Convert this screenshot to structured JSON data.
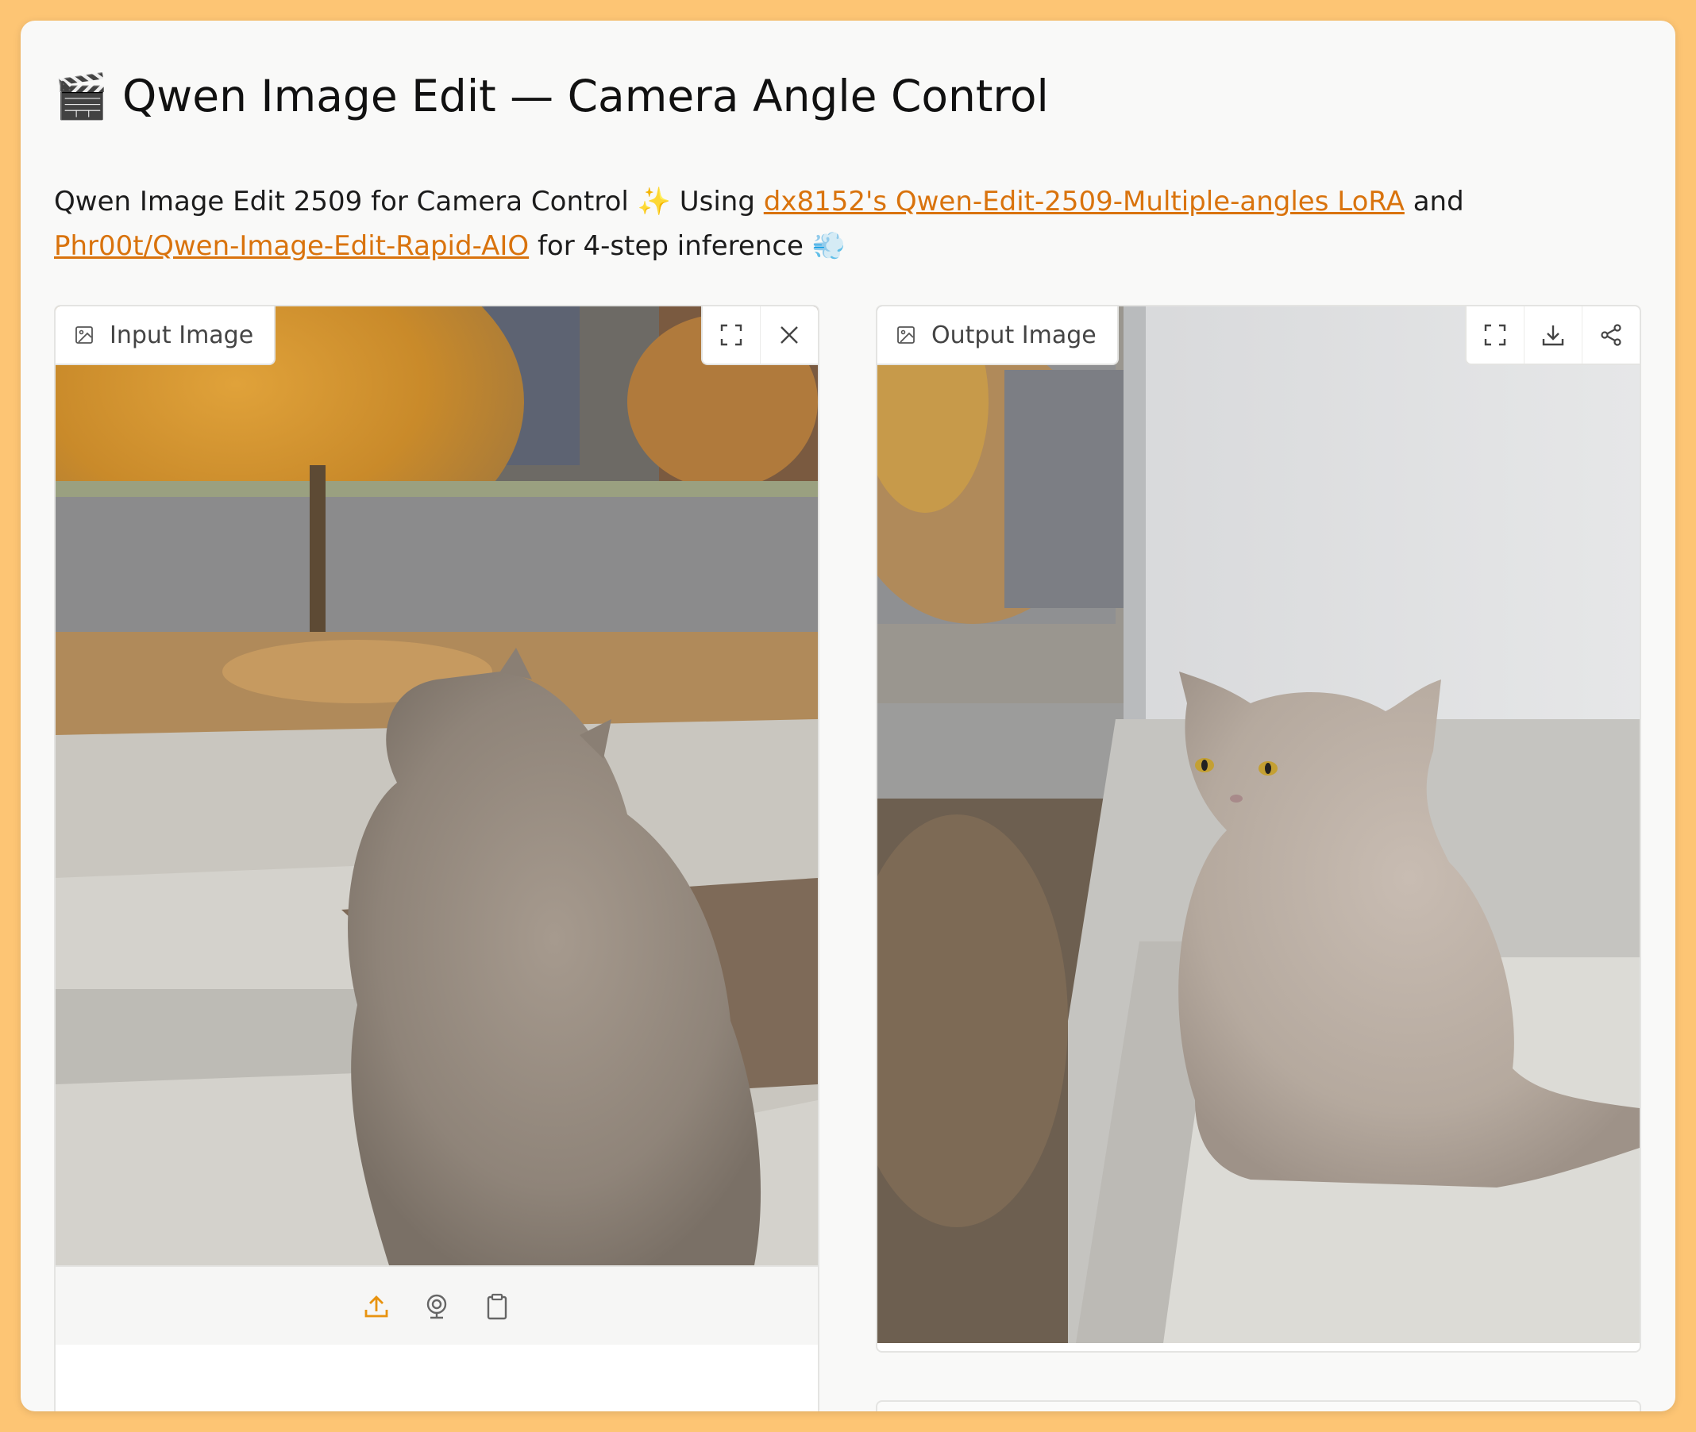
{
  "app": {
    "title_icon": "🎬",
    "title": "Qwen Image Edit — Camera Angle Control"
  },
  "description": {
    "text1": "Qwen Image Edit 2509 for Camera Control ✨ Using ",
    "link1": "dx8152's Qwen-Edit-2509-Multiple-angles LoRA",
    "text2": " and ",
    "link2": "Phr00t/Qwen-Image-Edit-Rapid-AIO",
    "text3": " for 4-step inference 💨"
  },
  "input_panel": {
    "label": "Input Image",
    "icons": [
      "image-icon",
      "fullscreen-icon",
      "close-icon",
      "upload-icon",
      "webcam-icon",
      "clipboard-icon"
    ]
  },
  "output_panel": {
    "label": "Output Image",
    "icons": [
      "image-icon",
      "fullscreen-icon",
      "download-icon",
      "share-icon"
    ]
  },
  "colors": {
    "background": "#fdc574",
    "accent": "#d9730d",
    "panel_border": "#e4e4e2"
  }
}
